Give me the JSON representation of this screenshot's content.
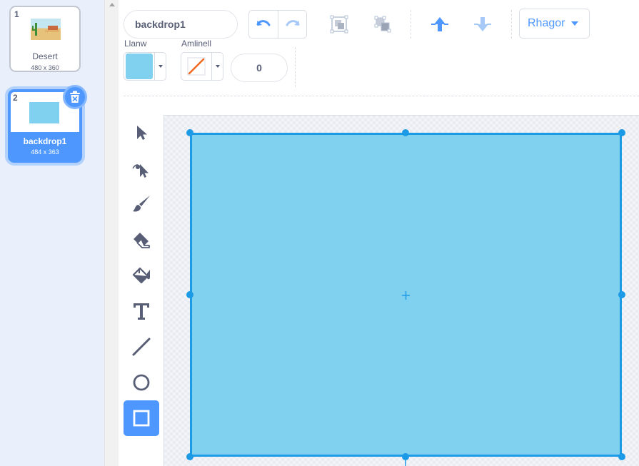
{
  "costumes": [
    {
      "number": "1",
      "name": "Desert",
      "size": "480 x 360",
      "selected": false,
      "thumbnail": "desert-scene"
    },
    {
      "number": "2",
      "name": "backdrop1",
      "size": "484 x 363",
      "selected": true,
      "thumbnail": "blue-rectangle"
    }
  ],
  "toolbar": {
    "costume_name": "backdrop1",
    "mode_label": "Rhagor",
    "fill_label": "Llanw",
    "outline_label": "Amlinell",
    "outline_width": "0",
    "fill_color": "#80d0ef",
    "outline_color": "none"
  },
  "tools": [
    {
      "name": "select",
      "icon": "arrow-pointer-icon",
      "active": false
    },
    {
      "name": "reshape",
      "icon": "reshape-icon",
      "active": false
    },
    {
      "name": "brush",
      "icon": "brush-icon",
      "active": false
    },
    {
      "name": "eraser",
      "icon": "eraser-icon",
      "active": false
    },
    {
      "name": "fill",
      "icon": "paint-bucket-icon",
      "active": false
    },
    {
      "name": "text",
      "icon": "text-icon",
      "active": false
    },
    {
      "name": "line",
      "icon": "line-icon",
      "active": false
    },
    {
      "name": "circle",
      "icon": "circle-icon",
      "active": false
    },
    {
      "name": "rectangle",
      "icon": "rectangle-icon",
      "active": true
    }
  ],
  "colors": {
    "accent": "#4d97ff",
    "shape_fill": "#80d0ef",
    "selection": "#1d9ae5",
    "text": "#575e75"
  }
}
